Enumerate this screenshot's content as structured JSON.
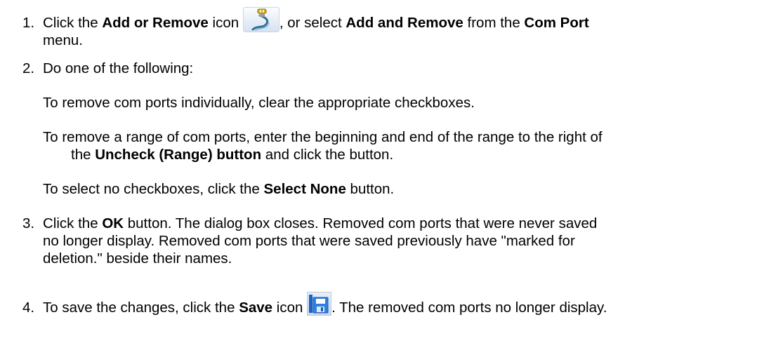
{
  "steps": [
    {
      "number": "1.",
      "lines": [
        {
          "t1": "Click the ",
          "b1": "Add or Remove",
          "t2": " icon ",
          "t3": ", or select ",
          "b2": "Add and Remove",
          "t4": " from the ",
          "b3": "Com Port"
        },
        {
          "t1": "menu."
        }
      ],
      "icon": "add-remove-icon"
    },
    {
      "number": "2.",
      "lines": [
        {
          "t1": "Do one of the following:"
        }
      ],
      "options": [
        {
          "t1": "To remove com ports individually, clear the appropriate checkboxes."
        },
        {
          "t1": "To remove a range of com ports, enter the beginning and end of the range to the right of",
          "t2": "the ",
          "b1": "Uncheck (Range) button",
          "t3": " and click the button."
        },
        {
          "t1": "To select no checkboxes, click the ",
          "b1": "Select None",
          "t2": " button."
        }
      ]
    },
    {
      "number": "3.",
      "lines": [
        {
          "t1": "Click the ",
          "b1": "OK",
          "t2": " button. The dialog box closes. Removed com ports that were never saved"
        },
        {
          "t1": "no longer display. Removed com ports that were saved previously have \"marked for"
        },
        {
          "t1": "deletion.\" beside their names."
        }
      ]
    },
    {
      "number": "4.",
      "lines": [
        {
          "t1": "To save the changes, click the ",
          "b1": "Save",
          "t2": " icon ",
          "t3": ". The removed com ports no longer display."
        }
      ],
      "icon": "save-icon"
    }
  ]
}
